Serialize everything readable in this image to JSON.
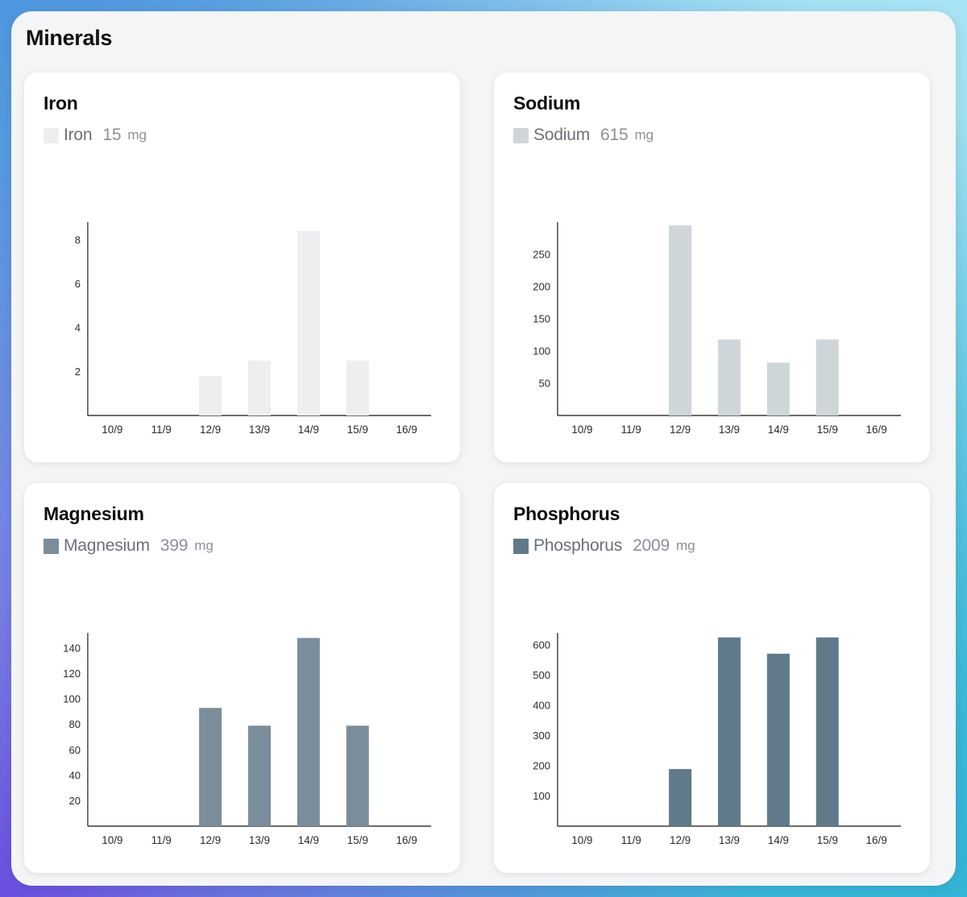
{
  "panel": {
    "title": "Minerals"
  },
  "cards": [
    {
      "title": "Iron",
      "legend_name": "Iron",
      "legend_value": "15",
      "legend_unit": "mg",
      "color": "#eceef0",
      "chart_data": {
        "type": "bar",
        "title": "Iron",
        "xlabel": "",
        "ylabel": "",
        "categories": [
          "10/9",
          "11/9",
          "12/9",
          "13/9",
          "14/9",
          "15/9",
          "16/9"
        ],
        "values": [
          0,
          0,
          1.8,
          2.5,
          8.4,
          2.5,
          0
        ],
        "yticks": [
          2,
          4,
          6,
          8
        ],
        "ylim": [
          0,
          8.8
        ],
        "grid": false,
        "legend": [
          "Iron 15 mg"
        ]
      }
    },
    {
      "title": "Sodium",
      "legend_name": "Sodium",
      "legend_value": "615",
      "legend_unit": "mg",
      "color": "#ced6da",
      "chart_data": {
        "type": "bar",
        "title": "Sodium",
        "xlabel": "",
        "ylabel": "",
        "categories": [
          "10/9",
          "11/9",
          "12/9",
          "13/9",
          "14/9",
          "15/9",
          "16/9"
        ],
        "values": [
          0,
          0,
          295,
          118,
          82,
          118,
          0
        ],
        "yticks": [
          50,
          100,
          150,
          200,
          250
        ],
        "ylim": [
          0,
          300
        ],
        "grid": false,
        "legend": [
          "Sodium 615 mg"
        ]
      }
    },
    {
      "title": "Magnesium",
      "legend_name": "Magnesium",
      "legend_value": "399",
      "legend_unit": "mg",
      "color": "#7b8d9a",
      "chart_data": {
        "type": "bar",
        "title": "Magnesium",
        "xlabel": "",
        "ylabel": "",
        "categories": [
          "10/9",
          "11/9",
          "12/9",
          "13/9",
          "14/9",
          "15/9",
          "16/9"
        ],
        "values": [
          0,
          0,
          93,
          79,
          148,
          79,
          0
        ],
        "yticks": [
          20,
          40,
          60,
          80,
          100,
          120,
          140
        ],
        "ylim": [
          0,
          152
        ],
        "grid": false,
        "legend": [
          "Magnesium 399 mg"
        ]
      }
    },
    {
      "title": "Phosphorus",
      "legend_name": "Phosphorus",
      "legend_value": "2009",
      "legend_unit": "mg",
      "color": "#607a89",
      "chart_data": {
        "type": "bar",
        "title": "Phosphorus",
        "xlabel": "",
        "ylabel": "",
        "categories": [
          "10/9",
          "11/9",
          "12/9",
          "13/9",
          "14/9",
          "15/9",
          "16/9"
        ],
        "values": [
          0,
          0,
          189,
          625,
          571,
          625,
          0
        ],
        "yticks": [
          100,
          200,
          300,
          400,
          500,
          600
        ],
        "ylim": [
          0,
          640
        ],
        "grid": false,
        "legend": [
          "Phosphorus 2009 mg"
        ]
      }
    }
  ]
}
